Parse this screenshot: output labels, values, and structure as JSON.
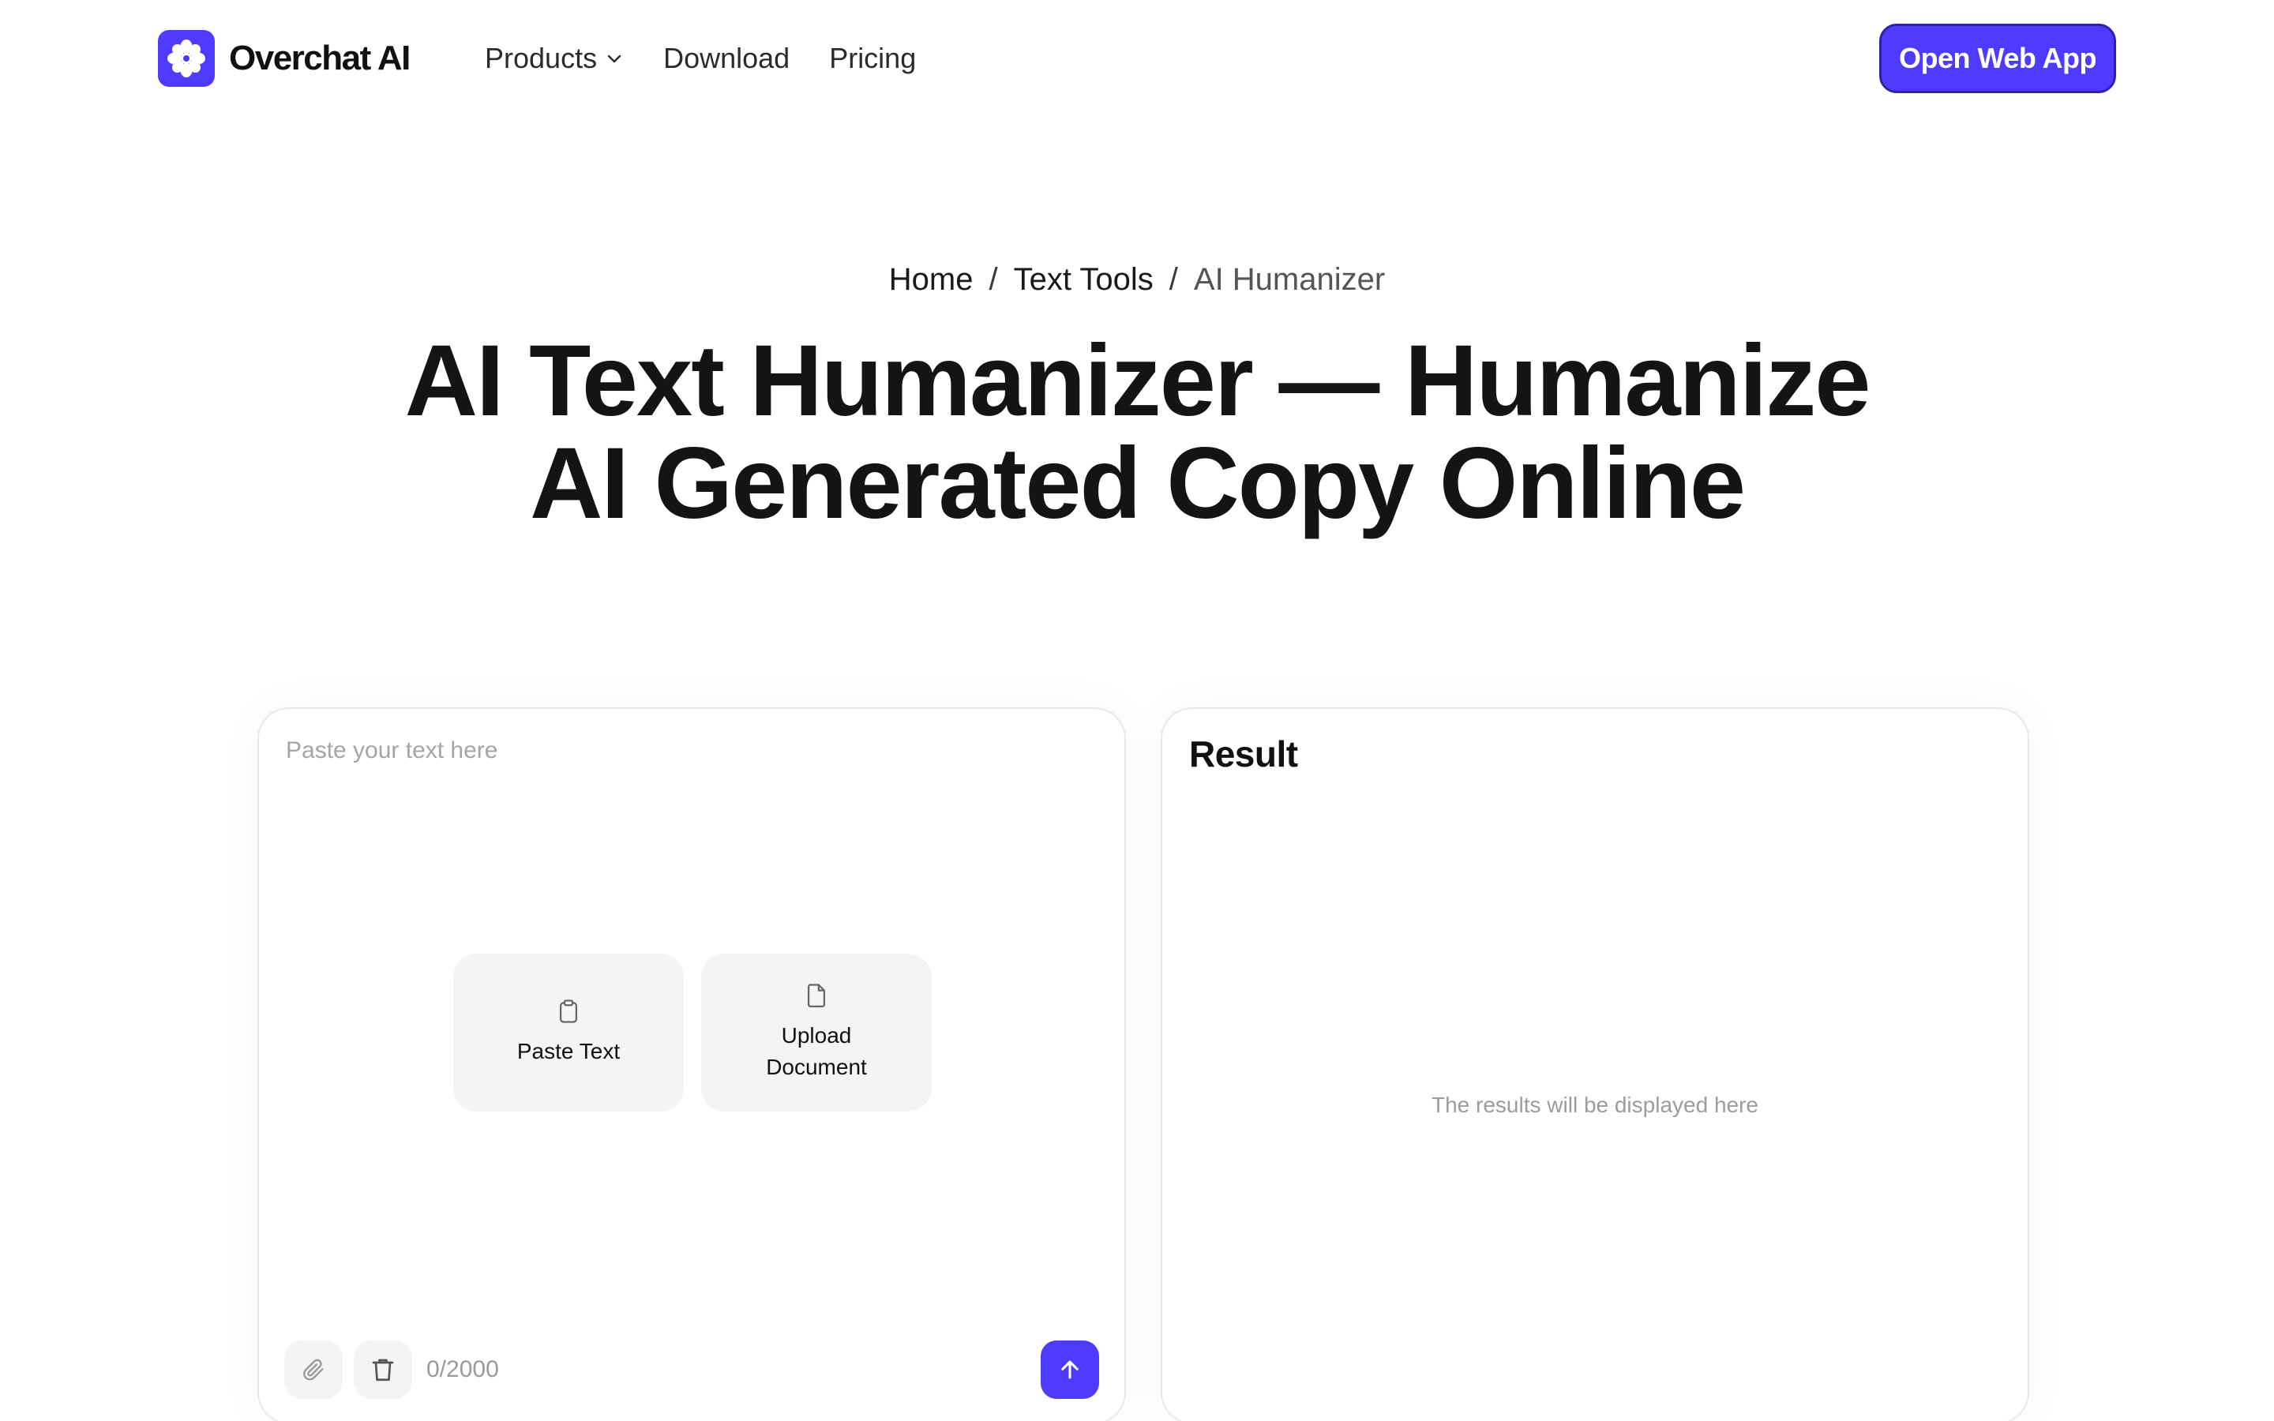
{
  "header": {
    "logo_text": "Overchat AI",
    "nav": {
      "products": "Products",
      "download": "Download",
      "pricing": "Pricing"
    },
    "cta": "Open Web App"
  },
  "breadcrumb": {
    "home": "Home",
    "separator": "/",
    "text_tools": "Text Tools",
    "current": "AI Humanizer"
  },
  "hero": {
    "title_line1": "AI Text Humanizer — Humanize",
    "title_line2": "AI Generated Copy Online"
  },
  "input_panel": {
    "placeholder": "Paste your text here",
    "paste_text_label": "Paste Text",
    "upload_document_label": "Upload Document",
    "char_count": "0/2000"
  },
  "result_panel": {
    "title": "Result",
    "empty_message": "The results will be displayed here"
  },
  "colors": {
    "accent": "#4f3bff",
    "text": "#111111",
    "muted": "#a5a5a5",
    "card": "#f4f4f4"
  },
  "icons": {
    "logo": "asterisk-flower-icon",
    "products_caret": "chevron-down-icon",
    "paste": "clipboard-icon",
    "upload": "document-icon",
    "attach": "paperclip-icon",
    "clear": "trash-icon",
    "send": "arrow-up-icon"
  }
}
